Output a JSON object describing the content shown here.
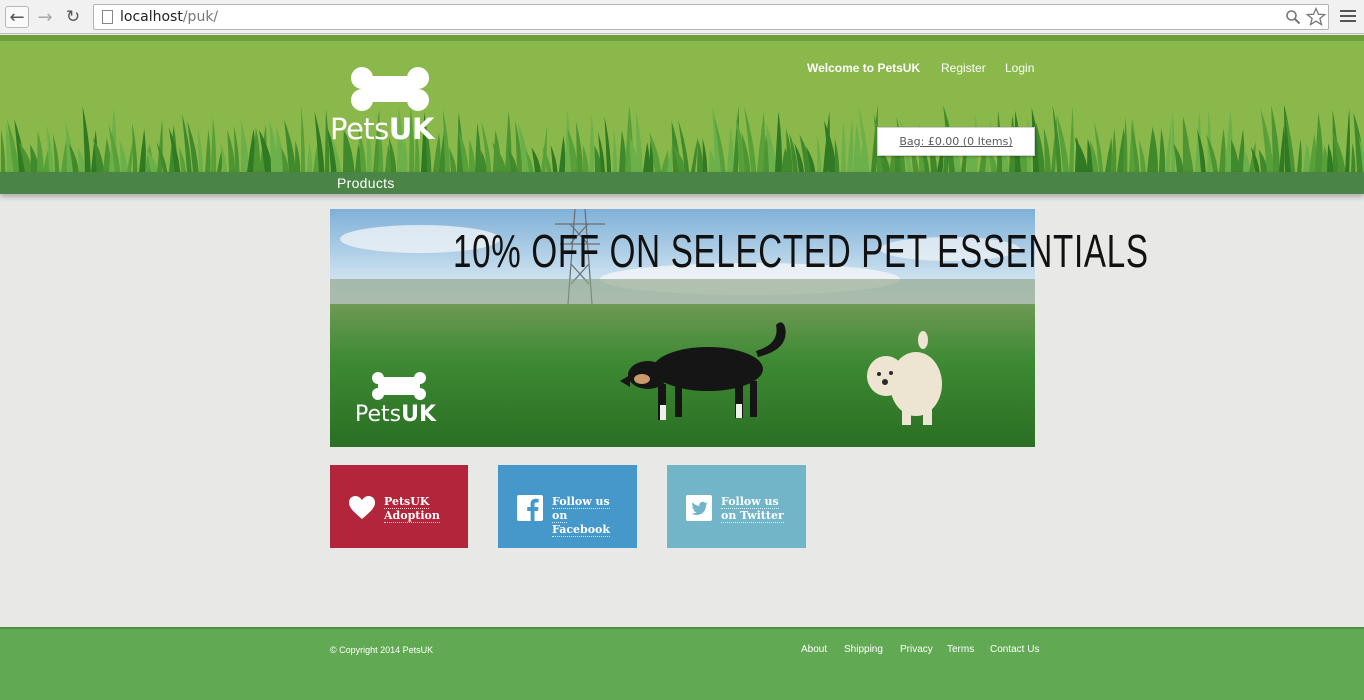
{
  "browser": {
    "url_host": "localhost",
    "url_path": "/puk/"
  },
  "header": {
    "logo_text_light": "Pets",
    "logo_text_bold": "UK",
    "welcome": "Welcome to PetsUK",
    "register": "Register",
    "login": "Login",
    "bag": "Bag: £0.00 (0 Items)"
  },
  "nav": {
    "products": "Products"
  },
  "banner": {
    "headline": "10% OFF ON SELECTED PET ESSENTIALS",
    "logo_text_light": "Pets",
    "logo_text_bold": "UK"
  },
  "tiles": [
    {
      "line1": "PetsUK",
      "line2": "Adoption",
      "icon": "heart-icon",
      "color": "#b3253a"
    },
    {
      "line1": "Follow us",
      "line2": "on",
      "line3": "Facebook",
      "icon": "facebook-icon",
      "color": "#4698cb"
    },
    {
      "line1": "Follow us",
      "line2": "on Twitter",
      "icon": "twitter-icon",
      "color": "#72b5c8"
    }
  ],
  "footer": {
    "copyright": "© Copyright 2014 PetsUK",
    "links": [
      "About",
      "Shipping",
      "Privacy",
      "Terms",
      "Contact Us"
    ]
  },
  "colors": {
    "header_green": "#8ab84a",
    "nav_green": "#4a8446",
    "footer_green": "#62a954"
  }
}
